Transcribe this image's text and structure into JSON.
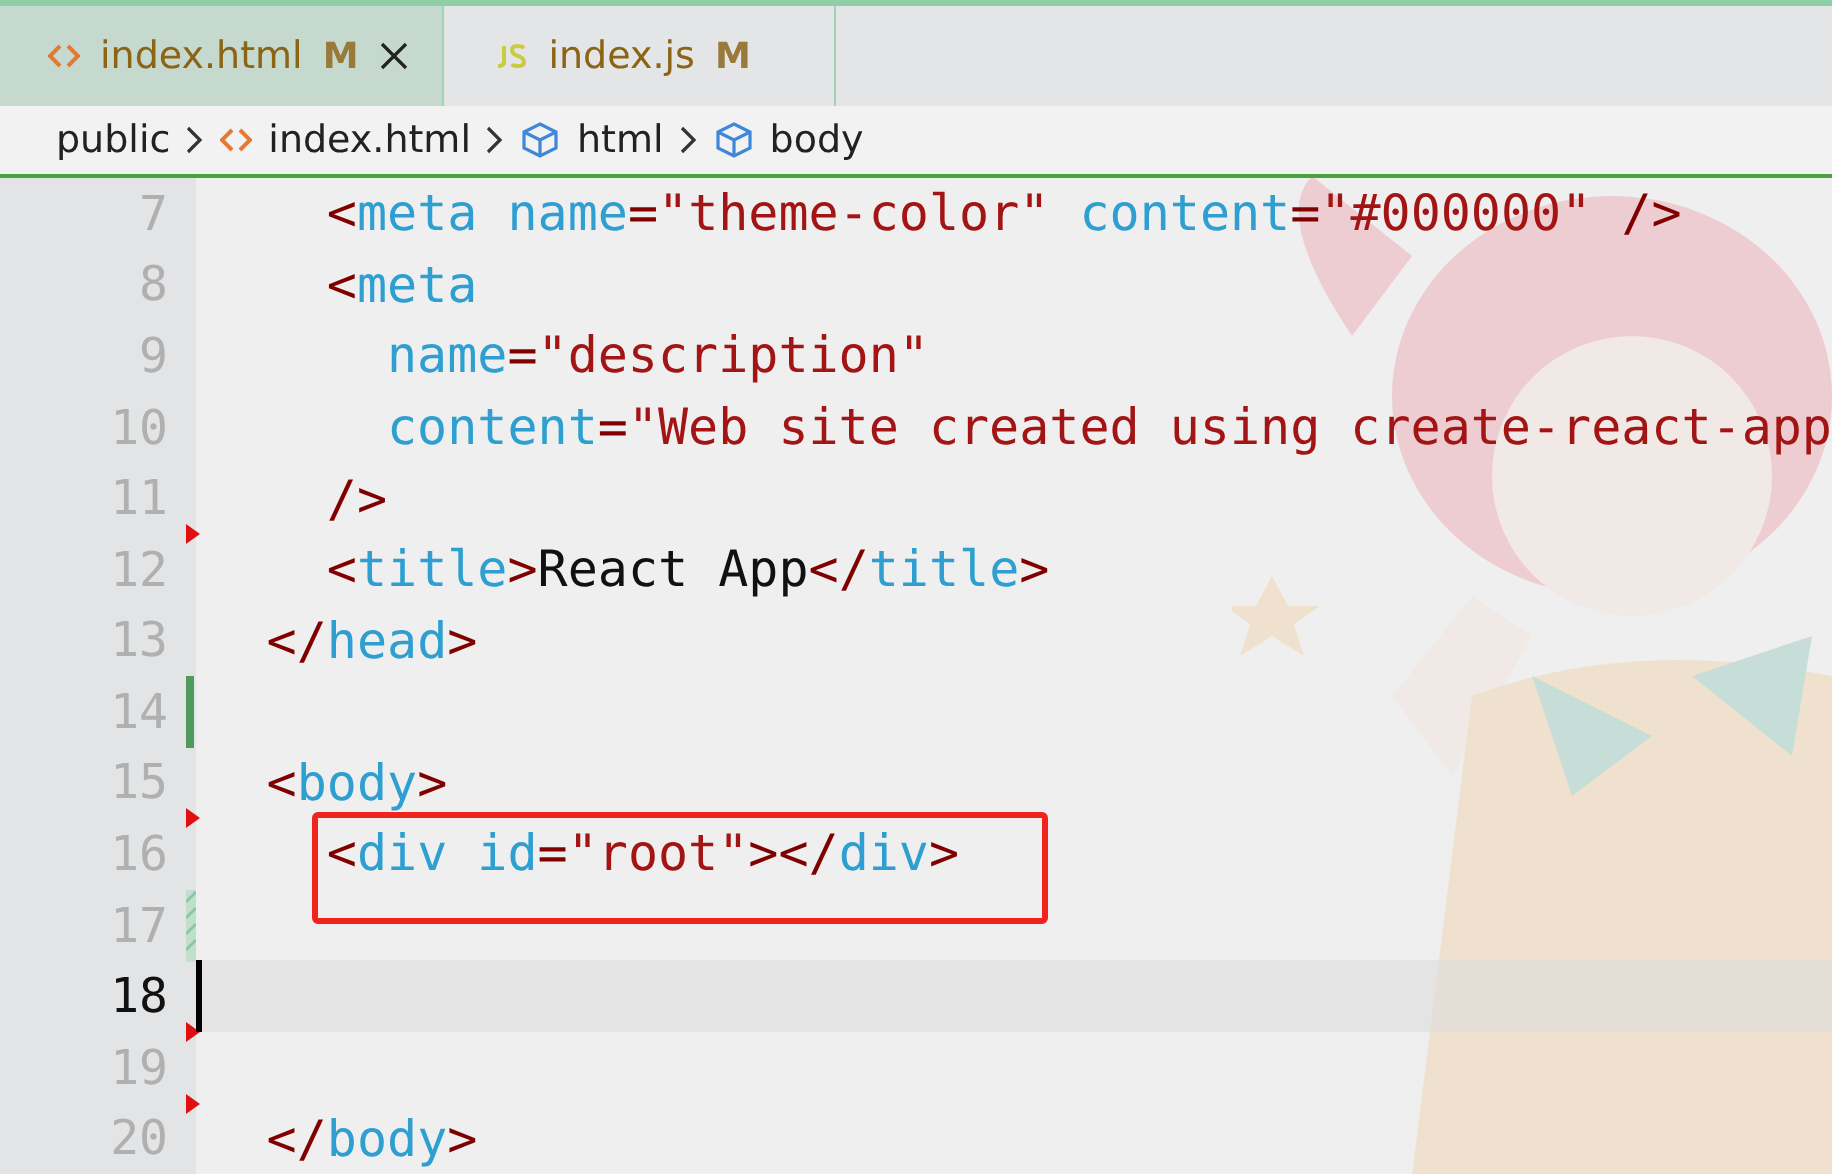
{
  "tabs": [
    {
      "kind": "html",
      "label": "index.html",
      "badge": "M",
      "selected": true
    },
    {
      "kind": "js",
      "label": "index.js",
      "badge": "M",
      "selected": false
    }
  ],
  "breadcrumb": [
    {
      "kind": "folder",
      "label": "public"
    },
    {
      "kind": "html",
      "label": "index.html"
    },
    {
      "kind": "element",
      "label": "html"
    },
    {
      "kind": "element",
      "label": "body"
    }
  ],
  "editor": {
    "lines": [
      {
        "number": "7",
        "current": false,
        "boxed": false,
        "tokens": [
          {
            "kind": "punct",
            "s": "    <"
          },
          {
            "kind": "tag",
            "s": "meta"
          },
          {
            "kind": "attr",
            "s": " name"
          },
          {
            "kind": "punct",
            "s": "="
          },
          {
            "kind": "str",
            "s": "\"theme-color\""
          },
          {
            "kind": "attr",
            "s": " content"
          },
          {
            "kind": "punct",
            "s": "="
          },
          {
            "kind": "str",
            "s": "\"#000000\""
          },
          {
            "kind": "punct",
            "s": " />"
          }
        ]
      },
      {
        "number": "8",
        "current": false,
        "boxed": false,
        "tokens": [
          {
            "kind": "punct",
            "s": "    <"
          },
          {
            "kind": "tag",
            "s": "meta"
          }
        ]
      },
      {
        "number": "9",
        "current": false,
        "boxed": false,
        "tokens": [
          {
            "kind": "attr",
            "s": "      name"
          },
          {
            "kind": "punct",
            "s": "="
          },
          {
            "kind": "str",
            "s": "\"description\""
          }
        ]
      },
      {
        "number": "10",
        "current": false,
        "boxed": false,
        "tokens": [
          {
            "kind": "attr",
            "s": "      content"
          },
          {
            "kind": "punct",
            "s": "="
          },
          {
            "kind": "str",
            "s": "\"Web site created using create-react-app"
          }
        ]
      },
      {
        "number": "11",
        "gutter_mark": {
          "kind": "deleted"
        },
        "current": false,
        "boxed": false,
        "tokens": [
          {
            "kind": "punct",
            "s": "    />"
          }
        ]
      },
      {
        "number": "12",
        "current": false,
        "boxed": false,
        "tokens": [
          {
            "kind": "punct",
            "s": "    <"
          },
          {
            "kind": "tag",
            "s": "title"
          },
          {
            "kind": "punct",
            "s": ">"
          },
          {
            "kind": "text",
            "s": "React App"
          },
          {
            "kind": "punct",
            "s": "</"
          },
          {
            "kind": "tag",
            "s": "title"
          },
          {
            "kind": "punct",
            "s": ">"
          }
        ]
      },
      {
        "number": "13",
        "current": false,
        "boxed": false,
        "tokens": [
          {
            "kind": "punct",
            "s": "  </"
          },
          {
            "kind": "tag",
            "s": "head"
          },
          {
            "kind": "punct",
            "s": ">"
          }
        ]
      },
      {
        "number": "14",
        "gutter_mark": {
          "kind": "added"
        },
        "current": false,
        "boxed": false
      },
      {
        "number": "15",
        "gutter_mark": {
          "kind": "deleted"
        },
        "current": false,
        "boxed": false,
        "tokens": [
          {
            "kind": "punct",
            "s": "  <"
          },
          {
            "kind": "tag",
            "s": "body"
          },
          {
            "kind": "punct",
            "s": ">"
          }
        ]
      },
      {
        "number": "16",
        "current": false,
        "boxed": true,
        "tokens": [
          {
            "kind": "punct",
            "s": "    <"
          },
          {
            "kind": "tag",
            "s": "div"
          },
          {
            "kind": "attr",
            "s": " id"
          },
          {
            "kind": "punct",
            "s": "="
          },
          {
            "kind": "str",
            "s": "\"root\""
          },
          {
            "kind": "punct",
            "s": "></"
          },
          {
            "kind": "tag",
            "s": "div"
          },
          {
            "kind": "punct",
            "s": ">"
          }
        ]
      },
      {
        "number": "17",
        "gutter_mark": {
          "kind": "modified"
        },
        "current": false,
        "boxed": false
      },
      {
        "number": "18",
        "gutter_mark": {
          "kind": "deleted"
        },
        "current": true,
        "boxed": false
      },
      {
        "number": "19",
        "gutter_mark": {
          "kind": "deleted"
        },
        "current": false,
        "boxed": false
      },
      {
        "number": "20",
        "current": false,
        "boxed": false,
        "tokens": [
          {
            "kind": "punct",
            "s": "  </"
          },
          {
            "kind": "tag",
            "s": "body"
          },
          {
            "kind": "punct",
            "s": ">"
          }
        ]
      }
    ]
  }
}
